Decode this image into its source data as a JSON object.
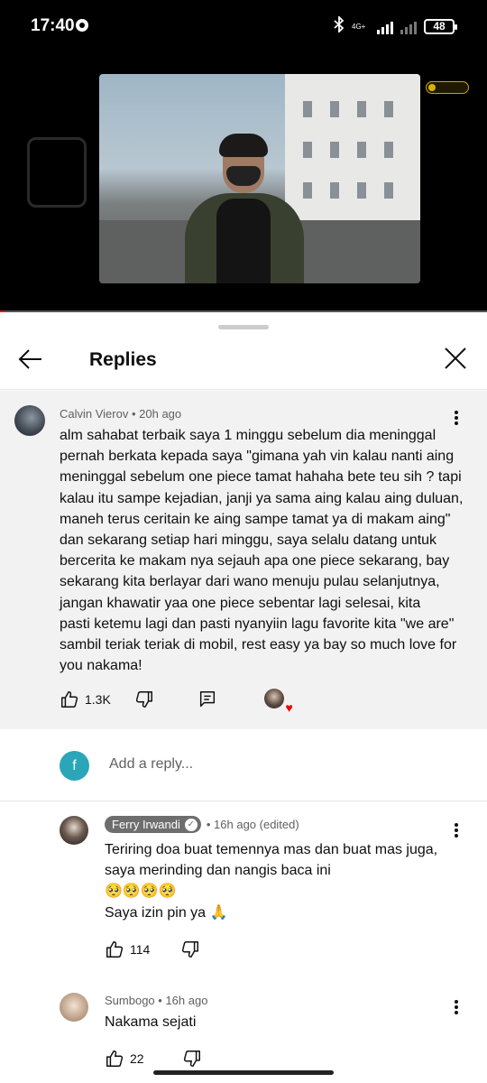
{
  "status_bar": {
    "time": "17:40",
    "network": "4G+",
    "battery": "48"
  },
  "video": {
    "progress_percent": 1
  },
  "sheet": {
    "title": "Replies"
  },
  "parent_comment": {
    "author": "Calvin Vierov",
    "age": "20h ago",
    "lines": [
      "alm sahabat terbaik saya 1 minggu sebelum dia meninggal",
      "pernah berkata kepada saya \"gimana yah vin kalau nanti aing",
      "meninggal sebelum one piece tamat hahaha bete teu sih ? tapi",
      "kalau itu sampe kejadian, janji ya sama aing kalau aing duluan,",
      "maneh terus ceritain ke aing sampe tamat ya di makam aing\"",
      "dan sekarang setiap hari minggu, saya selalu datang untuk",
      "bercerita ke makam nya sejauh apa one piece sekarang, bay",
      "sekarang kita berlayar dari wano menuju pulau selanjutnya,",
      "jangan khawatir yaa one piece sebentar lagi selesai,  kita",
      "pasti  ketemu lagi dan pasti nyanyiin lagu favorite kita \"we are\"",
      "sambil teriak teriak di mobil, rest easy ya bay so much love for",
      "you nakama!"
    ],
    "likes": "1.3K"
  },
  "add_reply": {
    "avatar_letter": "f",
    "placeholder": "Add a reply..."
  },
  "replies": [
    {
      "author": "Ferry Irwandi",
      "age": "16h ago (edited)",
      "lines": [
        "Teriring doa buat temennya mas dan buat mas juga,",
        "saya merinding dan nangis baca ini",
        "🥺🥺🥺🥺",
        "Saya izin pin ya 🙏"
      ],
      "likes": "114"
    },
    {
      "author": "Sumbogo",
      "age": "16h ago",
      "lines": [
        "Nakama sejati"
      ],
      "likes": "22"
    }
  ],
  "colors": {
    "accent_red": "#ff0000",
    "parent_bg": "#f2f2f2",
    "self_avatar": "#2aa6b8"
  }
}
